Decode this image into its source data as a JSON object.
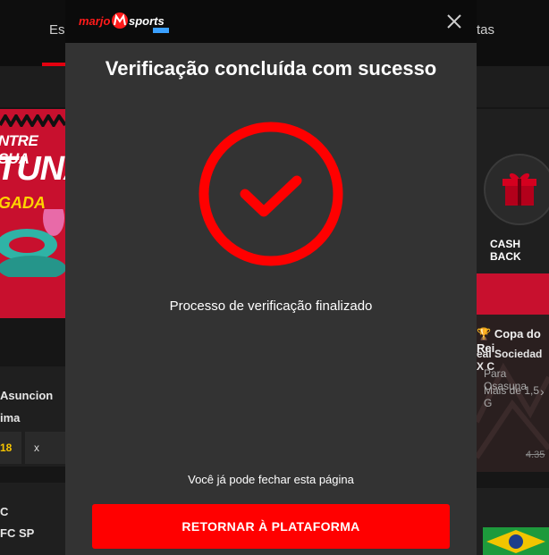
{
  "background": {
    "nav_left_label": "Esp",
    "nav_right_label": "tas",
    "banner": {
      "line1": "NTRE SUA",
      "line2": "TUNA",
      "line3": "GADA"
    },
    "match_left": {
      "team_a": "Asuncion",
      "team_b": "ima",
      "odd": "18",
      "odd_x": "x"
    },
    "match_left_2": {
      "team_a": "C",
      "team_b": "FC SP"
    },
    "cashback_label": "CASH BACK",
    "promo": {
      "competition": "Copa do Rei",
      "match": "eal Sociedad X C",
      "line1": "Para Osasuna",
      "line2": "Mais de 1,5 G",
      "old_price": "4.35",
      "arrow": "›"
    }
  },
  "modal": {
    "brand": "marjo sports",
    "brand_badge": "sports",
    "title": "Verificação concluída com sucesso",
    "status_icon": "check-circle-icon",
    "message": "Processo de verificação finalizado",
    "close_hint": "Você já pode fechar esta página",
    "return_button": "RETORNAR À PLATAFORMA",
    "close_icon": "close-icon"
  },
  "colors": {
    "accent": "#ff0000",
    "modal_bg": "#333333",
    "header_bg": "#0b0b0b"
  }
}
